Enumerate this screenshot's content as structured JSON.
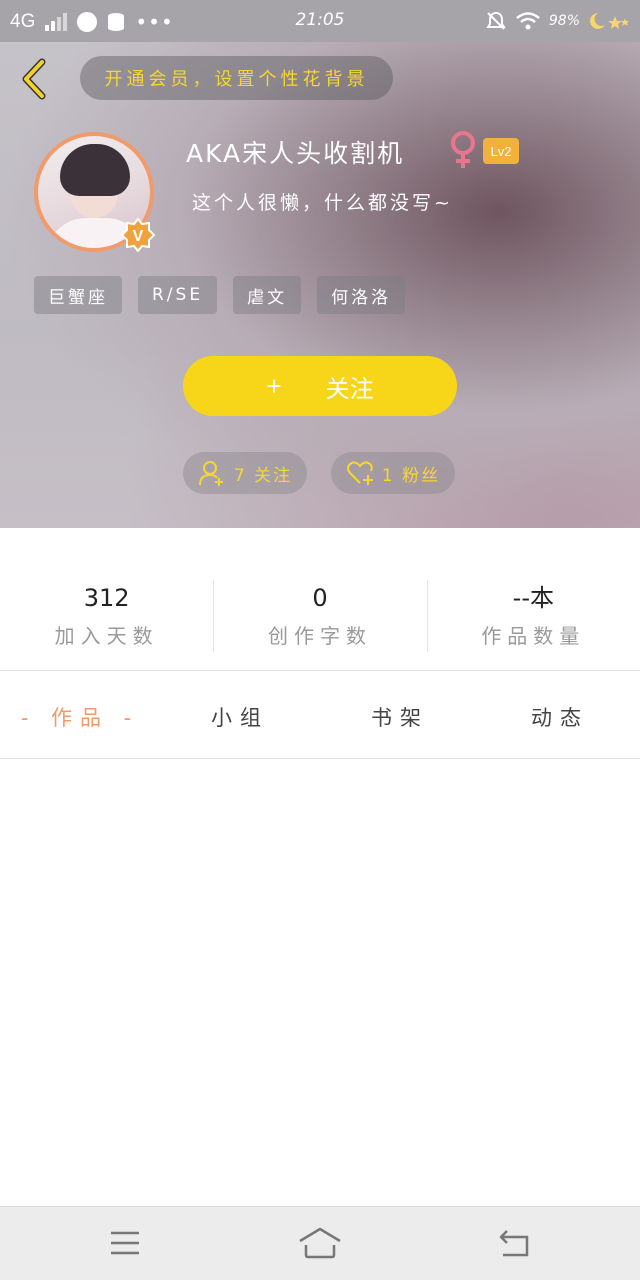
{
  "status_bar": {
    "network": "4G",
    "time": "21:05",
    "battery": "98%",
    "dots": "•••"
  },
  "header": {
    "vip_banner": "开通会员，设置个性花背景",
    "username": "AKA宋人头收割机",
    "level": "Lv2",
    "bio": "这个人很懒，什么都没写~",
    "vip_badge": "V",
    "tags": [
      "巨蟹座",
      "R/SE",
      "虐文",
      "何洛洛"
    ],
    "follow_plus": "+",
    "follow_label": "关注",
    "following_count": "7 关注",
    "fans_count": "1 粉丝",
    "colors": {
      "accent_yellow": "#f7d61a",
      "avatar_border": "#f19a6b",
      "level_badge": "#f2b23a",
      "gender": "#e8768f"
    }
  },
  "stats": [
    {
      "value": "312",
      "label": "加入天数"
    },
    {
      "value": "0",
      "label": "创作字数"
    },
    {
      "value": "--本",
      "label": "作品数量"
    }
  ],
  "tabs": [
    {
      "label": "- 作品 -",
      "active": true
    },
    {
      "label": "小组",
      "active": false
    },
    {
      "label": "书架",
      "active": false
    },
    {
      "label": "动态",
      "active": false
    }
  ],
  "icons": [
    "back-chevron-icon",
    "female-icon",
    "user-plus-icon",
    "heart-plus-icon",
    "menu-icon",
    "home-icon",
    "return-icon"
  ]
}
